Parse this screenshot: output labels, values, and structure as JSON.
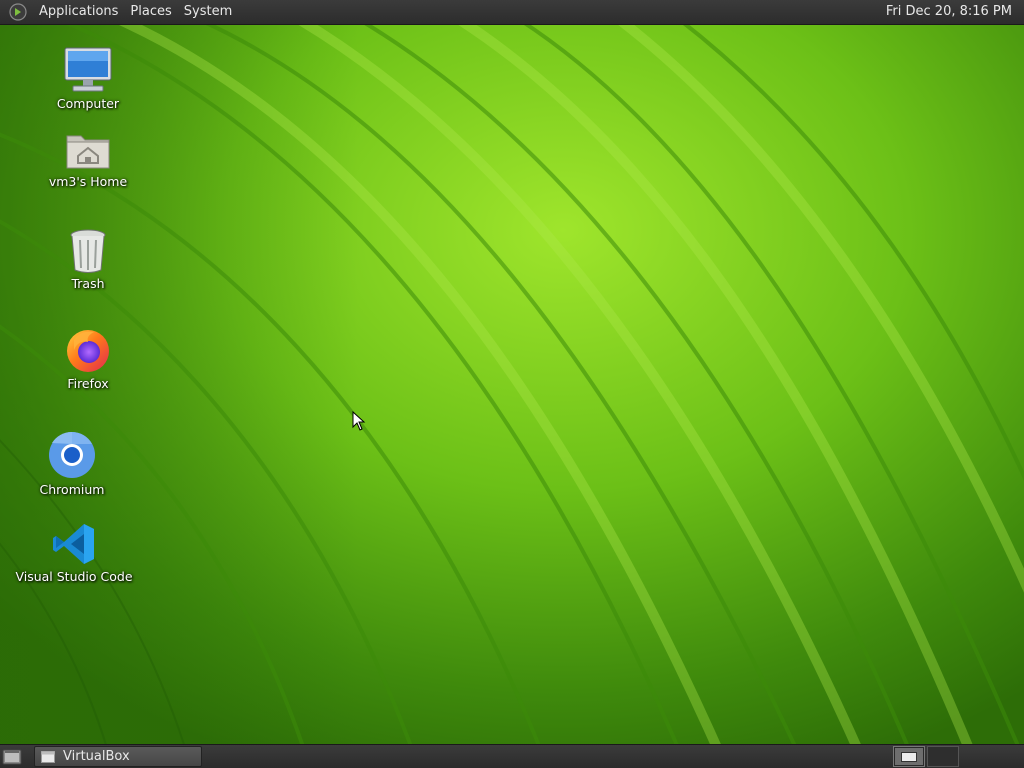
{
  "top_panel": {
    "menus": [
      "Applications",
      "Places",
      "System"
    ],
    "clock": "Fri Dec 20,  8:16 PM"
  },
  "desktop": {
    "wallpaper": "green-leaf",
    "icons": [
      {
        "label": "Computer",
        "icon": "computer-icon"
      },
      {
        "label": "vm3's Home",
        "icon": "home-folder-icon"
      },
      {
        "label": "Trash",
        "icon": "trash-icon"
      },
      {
        "label": "Firefox",
        "icon": "firefox-icon"
      },
      {
        "label": "Chromium",
        "icon": "chromium-icon"
      },
      {
        "label": "Visual Studio Code",
        "icon": "vscode-icon"
      }
    ]
  },
  "bottom_panel": {
    "tasks": [
      {
        "label": "VirtualBox",
        "icon": "window-icon"
      }
    ]
  },
  "colors": {
    "panel": "#333333",
    "panel_text": "#e8e8e8",
    "wallpaper_green": "#6cc017"
  }
}
